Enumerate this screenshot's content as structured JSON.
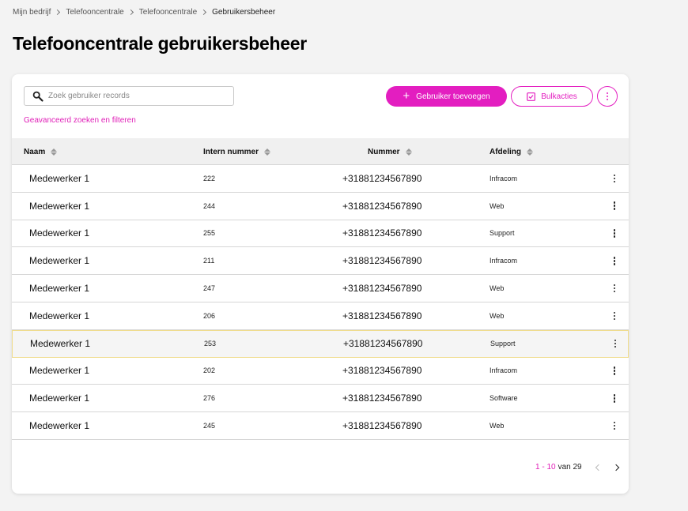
{
  "breadcrumb": [
    "Mijn bedrijf",
    "Telefooncentrale",
    "Telefooncentrale",
    "Gebruikersbeheer"
  ],
  "page_title": "Telefooncentrale gebruikersbeheer",
  "search": {
    "placeholder": "Zoek gebruiker records",
    "value": ""
  },
  "advanced_link": "Geavanceerd zoeken en filteren",
  "toolbar": {
    "add_label": "Gebruiker toevoegen",
    "bulk_label": "Bulkacties"
  },
  "columns": [
    "Naam",
    "Intern nummer",
    "Nummer",
    "Afdeling"
  ],
  "rows": [
    {
      "name": "Medewerker 1",
      "ext": "222",
      "number": "+31881234567890",
      "dept": "Infracom"
    },
    {
      "name": "Medewerker 1",
      "ext": "244",
      "number": "+31881234567890",
      "dept": "Web"
    },
    {
      "name": "Medewerker 1",
      "ext": "255",
      "number": "+31881234567890",
      "dept": "Support"
    },
    {
      "name": "Medewerker 1",
      "ext": "211",
      "number": "+31881234567890",
      "dept": "Infracom"
    },
    {
      "name": "Medewerker 1",
      "ext": "247",
      "number": "+31881234567890",
      "dept": "Web"
    },
    {
      "name": "Medewerker 1",
      "ext": "206",
      "number": "+31881234567890",
      "dept": "Web"
    },
    {
      "name": "Medewerker 1",
      "ext": "253",
      "number": "+31881234567890",
      "dept": "Support"
    },
    {
      "name": "Medewerker 1",
      "ext": "202",
      "number": "+31881234567890",
      "dept": "Infracom"
    },
    {
      "name": "Medewerker 1",
      "ext": "276",
      "number": "+31881234567890",
      "dept": "Software"
    },
    {
      "name": "Medewerker 1",
      "ext": "245",
      "number": "+31881234567890",
      "dept": "Web"
    }
  ],
  "pagination": {
    "range": "1 - 10",
    "of_label": "van 29"
  },
  "colors": {
    "accent": "#e31ec0",
    "highlight_border": "#f0dc8c"
  }
}
